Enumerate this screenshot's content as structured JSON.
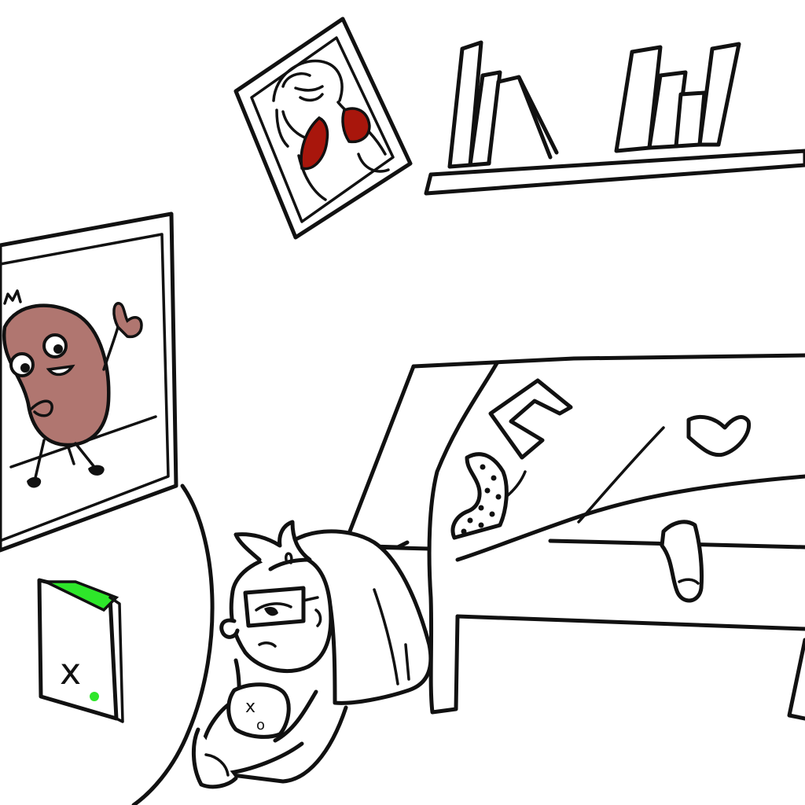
{
  "scene": {
    "type": "cartoon-illustration",
    "colors": {
      "line": "#111111",
      "background": "#ffffff",
      "bean_character": "#b07670",
      "poster_bikini": "#a8160c",
      "console_accent": "#2ee62a"
    },
    "console": {
      "logo_glyph": "x"
    },
    "controller": {
      "button_glyphs": [
        "x",
        "o"
      ]
    }
  }
}
